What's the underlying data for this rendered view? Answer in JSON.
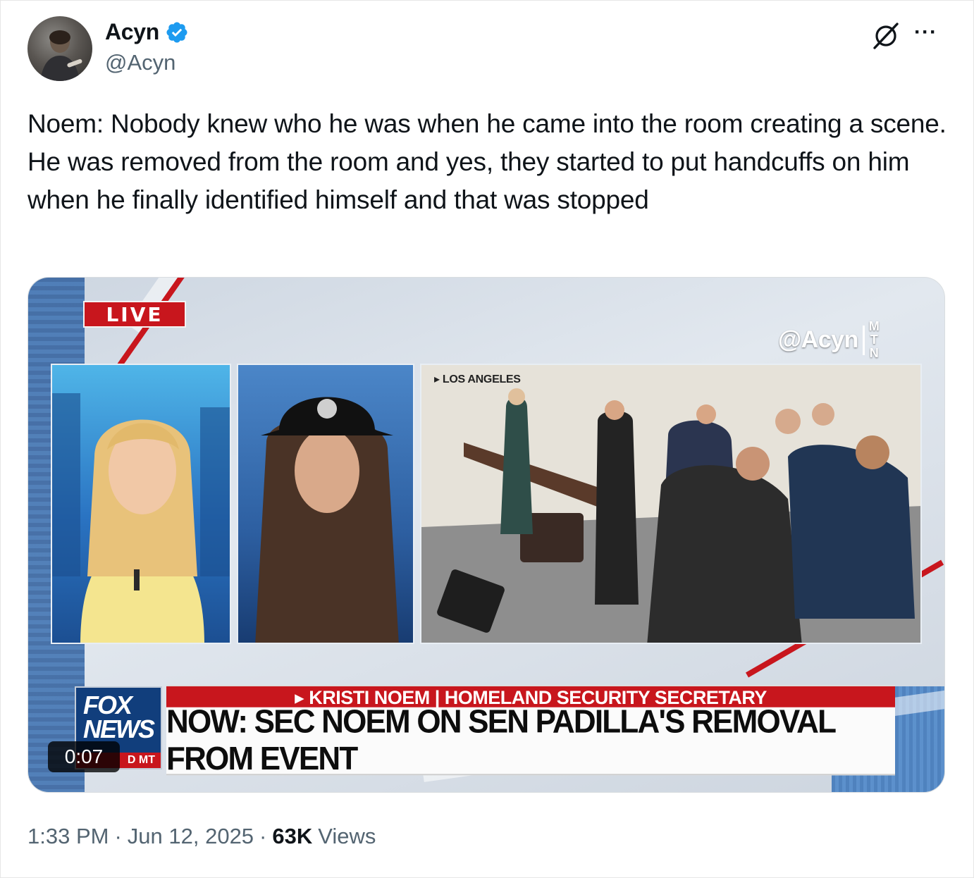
{
  "author": {
    "display_name": "Acyn",
    "handle": "@Acyn",
    "verified": true,
    "verified_color": "#1d9bf0"
  },
  "tweet": {
    "text": "Noem: Nobody knew who he was when he came into the room creating a scene. He was removed from the room and yes, they started to put handcuffs on him when he finally identified himself and that was stopped"
  },
  "actions": {
    "grok_icon": "grok-icon",
    "more_label": "···"
  },
  "video": {
    "live_label": "LIVE",
    "watermark_handle": "@Acyn",
    "watermark_brand": [
      "M",
      "T",
      "N"
    ],
    "location": "▸ LOS ANGELES",
    "chyron_top": "▸ KRISTI NOEM | HOMELAND SECURITY SECRETARY",
    "chyron_main": "NOW: SEC NOEM ON SEN PADILLA'S REMOVAL FROM EVENT",
    "network_line1": "FOX",
    "network_line2": "NEWS",
    "network_time": "D MT",
    "duration": "0:07",
    "accent_red": "#c8161d",
    "accent_blue": "#113e7c"
  },
  "meta": {
    "time": "1:33 PM",
    "separator": "·",
    "date": "Jun 12, 2025",
    "views_count": "63K",
    "views_label": "Views"
  }
}
